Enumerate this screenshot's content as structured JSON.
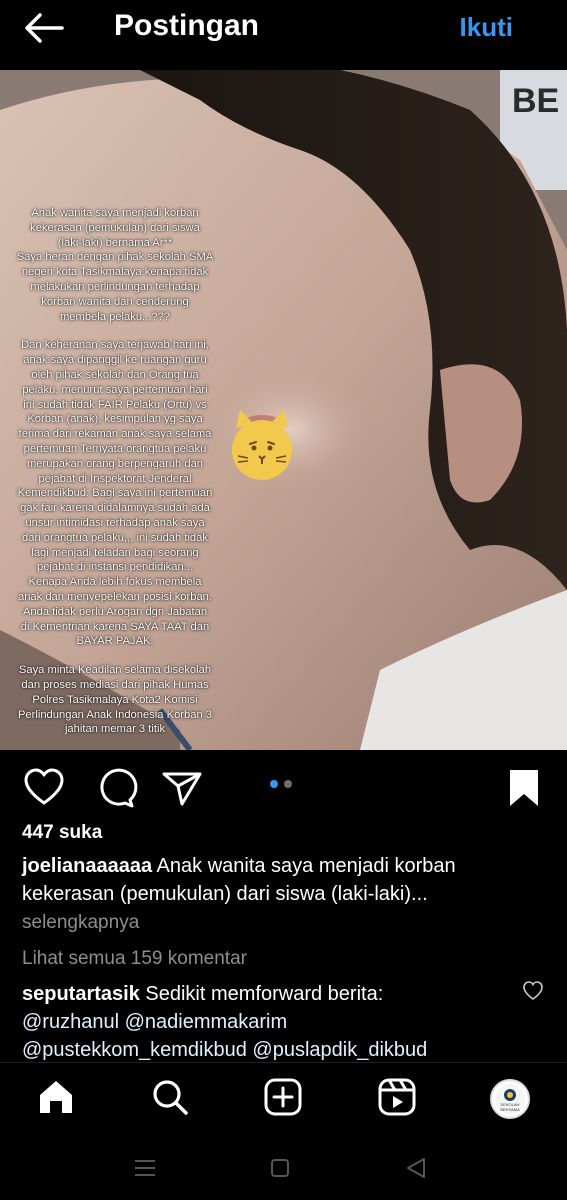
{
  "header": {
    "title": "Postingan",
    "follow_label": "Ikuti"
  },
  "post": {
    "story_paragraphs": [
      [
        "Anak wanita saya menjadi korban",
        "kekerasan (pemukulan) dari siswa",
        "(laki-laki) bernama Ar**",
        "Saya heran dengan pihak sekolah SMA",
        "negeri kota Tasikmalaya kenapa tidak",
        "melakukan perlindungan terhadap",
        "korban wanita dan cenderung",
        "membela pelaku...???"
      ],
      [
        "Dan keheranan saya terjawab hari ini,",
        "anak saya dipanggil ke ruangan guru",
        "oleh pihak sekolah dan Orang tua",
        "pelaku, menurut saya pertemuan hari",
        "ini sudah tidak FAIR Pelaku (Ortu) vs",
        "Korban (anak), kesimpulan yg saya",
        "terima dari rekaman anak saya selama",
        "pertemuan Ternyata orangtua pelaku",
        "merupakan orang berpengaruh dan",
        "pejabat di Inspektorat Jenderal",
        "Kemendikbud. Bagi saya ini pertemuan",
        "gak fair karena didalamnya sudah ada",
        "unsur intimidasi terhadap anak saya",
        "dari orangtua pelaku,,, ini sudah tidak",
        "lagi menjadi teladan bagi seorang",
        "pejabat di instansi pendidikan...",
        "Kenapa Anda lebih fokus membela",
        "anak dan menyepelekan posisi korban.",
        "Anda tidak perlu Arogan dgn Jabatan",
        "di Kementrian karena SAYA TAAT dan",
        "BAYAR PAJAK."
      ],
      [
        "Saya minta Keadilan selama disekolah",
        "dan proses mediasi dari pihak Humas",
        "Polres Tasikmalaya Kota2 Komisi",
        "Perlindungan Anak Indonesia Korban 3",
        "jahitan memar 3 titik"
      ]
    ],
    "background_sign_text": "BE",
    "carousel": {
      "total": 2,
      "active": 1
    },
    "likes_text": "447 suka",
    "caption": {
      "username": "joelianaaaaaa",
      "text": "Anak wanita saya menjadi korban kekerasan (pemukulan) dari siswa (laki-laki)..."
    },
    "more_label": "selengkapnya",
    "view_comments_label": "Lihat semua 159 komentar",
    "comment": {
      "username": "seputartasik",
      "text": "Sedikit memforward berita:",
      "mentions_line1": "@ruzhanul @nadiemmakarim",
      "mentions_line2": "@pustekkom_kemdikbud @puslapdik_dikbud"
    }
  },
  "icons": {
    "back": "arrow-left-icon",
    "like": "heart-icon",
    "comment": "comment-bubble-icon",
    "share": "paper-plane-icon",
    "save": "bookmark-icon",
    "home": "home-icon",
    "search": "search-icon",
    "create": "plus-square-icon",
    "reels": "reels-icon",
    "profile": "avatar"
  },
  "bottom_nav": {
    "avatar_text": "SEKOLAH BERSAMA"
  },
  "colors": {
    "background": "#000000",
    "accent": "#3897f0",
    "muted": "#8e8e8e"
  }
}
